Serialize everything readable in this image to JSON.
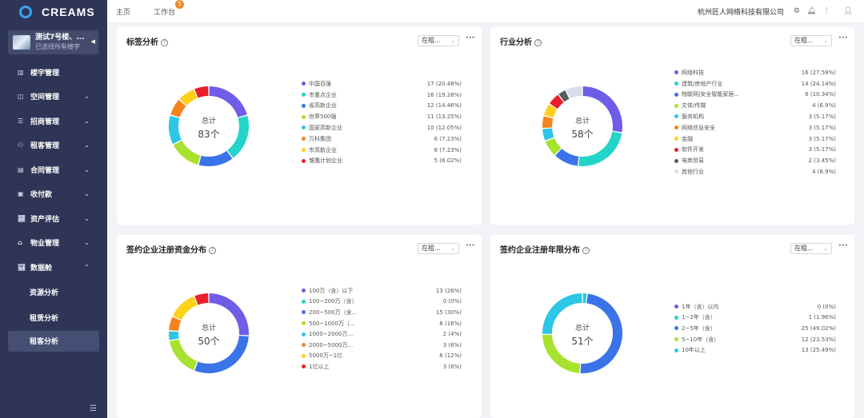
{
  "app": {
    "logo_text": "CREAMS"
  },
  "building": {
    "name": "测试7号楼、...",
    "sub": "已选择所有楼宇"
  },
  "nav": [
    {
      "label": "楼宇管理",
      "icon": "building-icon",
      "chevron": false
    },
    {
      "label": "空间管理",
      "icon": "space-icon",
      "chevron": true
    },
    {
      "label": "招商管理",
      "icon": "recruit-icon",
      "chevron": true
    },
    {
      "label": "租客管理",
      "icon": "tenant-icon",
      "chevron": true
    },
    {
      "label": "合同管理",
      "icon": "contract-icon",
      "chevron": true
    },
    {
      "label": "收付款",
      "icon": "payment-icon",
      "chevron": true
    },
    {
      "label": "资产评估",
      "icon": "asset-icon",
      "chevron": true
    },
    {
      "label": "物业管理",
      "icon": "property-icon",
      "chevron": true
    },
    {
      "label": "数据舱",
      "icon": "data-icon",
      "chevron": true,
      "expanded": true
    }
  ],
  "subnav": [
    "资源分析",
    "租赁分析",
    "租客分析"
  ],
  "header": {
    "tabs": [
      "主页",
      "工作台"
    ],
    "badge": "5",
    "company": "杭州匠人网络科技有限公司"
  },
  "colors": {
    "sidebar": "#2f3556",
    "palette": [
      "#6f5de8",
      "#23d5c8",
      "#3b73e8",
      "#a7e22e",
      "#2cc6e6",
      "#f5841f",
      "#ffd11a",
      "#e8202a",
      "#555a63",
      "#d9dfe8"
    ]
  },
  "cards": [
    {
      "title": "标签分析",
      "select": "在租...",
      "total_label": "总计",
      "total": "83个",
      "legend": [
        {
          "label": "中国百强",
          "value": "17 (20.48%)"
        },
        {
          "label": "市重点企业",
          "value": "16 (19.28%)"
        },
        {
          "label": "省高新企业",
          "value": "12 (14.46%)"
        },
        {
          "label": "世界500强",
          "value": "11 (13.25%)"
        },
        {
          "label": "国家高新企业",
          "value": "10 (12.05%)"
        },
        {
          "label": "万科集团",
          "value": "6 (7.23%)"
        },
        {
          "label": "市高新企业",
          "value": "6 (7.23%)"
        },
        {
          "label": "雏鹰计划企业",
          "value": "5 (6.02%)"
        }
      ],
      "segments": [
        17,
        16,
        12,
        11,
        10,
        6,
        6,
        5
      ],
      "color_idx": [
        0,
        1,
        2,
        3,
        4,
        5,
        6,
        7
      ]
    },
    {
      "title": "行业分析",
      "select": "在租...",
      "total_label": "总计",
      "total": "58个",
      "legend": [
        {
          "label": "网络科技",
          "value": "16 (27.59%)"
        },
        {
          "label": "建筑/房地产行业",
          "value": "14 (24.14%)"
        },
        {
          "label": "物联网|安全智能家居...",
          "value": "6 (10.34%)"
        },
        {
          "label": "文体/传媒",
          "value": "4 (6.9%)"
        },
        {
          "label": "服务机构",
          "value": "3 (5.17%)"
        },
        {
          "label": "网络信息安全",
          "value": "3 (5.17%)"
        },
        {
          "label": "金融",
          "value": "3 (5.17%)"
        },
        {
          "label": "软件开发",
          "value": "3 (5.17%)"
        },
        {
          "label": "电商贸易",
          "value": "2 (3.45%)"
        },
        {
          "label": "其他行业",
          "value": "4 (6.9%)"
        }
      ],
      "segments": [
        16,
        14,
        6,
        4,
        3,
        3,
        3,
        3,
        2,
        4
      ],
      "color_idx": [
        0,
        1,
        2,
        3,
        4,
        5,
        6,
        7,
        8,
        9
      ]
    },
    {
      "title": "签约企业注册资金分布",
      "select": "在租...",
      "total_label": "总计",
      "total": "50个",
      "legend": [
        {
          "label": "100万（含）以下",
          "value": "13 (26%)"
        },
        {
          "label": "100~200万（含）",
          "value": "0 (0%)"
        },
        {
          "label": "200~500万（含...",
          "value": "15 (30%)"
        },
        {
          "label": "500~1000万（...",
          "value": "8 (16%)"
        },
        {
          "label": "1000~2000万...",
          "value": "2 (4%)"
        },
        {
          "label": "2000~5000万...",
          "value": "3 (6%)"
        },
        {
          "label": "5000万~1亿",
          "value": "6 (12%)"
        },
        {
          "label": "1亿以上",
          "value": "3 (6%)"
        }
      ],
      "segments": [
        13,
        0,
        15,
        8,
        2,
        3,
        6,
        3
      ],
      "color_idx": [
        0,
        1,
        2,
        3,
        4,
        5,
        6,
        7
      ]
    },
    {
      "title": "签约企业注册年限分布",
      "select": "在租...",
      "total_label": "总计",
      "total": "51个",
      "legend": [
        {
          "label": "1年（含）以内",
          "value": "0 (0%)"
        },
        {
          "label": "1~2年（含）",
          "value": "1 (1.96%)"
        },
        {
          "label": "2~5年（含）",
          "value": "25 (49.02%)"
        },
        {
          "label": "5~10年（含）",
          "value": "12 (23.53%)"
        },
        {
          "label": "10年以上",
          "value": "13 (25.49%)"
        }
      ],
      "segments": [
        0,
        1,
        25,
        12,
        13
      ],
      "color_idx": [
        0,
        1,
        2,
        3,
        4
      ]
    }
  ]
}
